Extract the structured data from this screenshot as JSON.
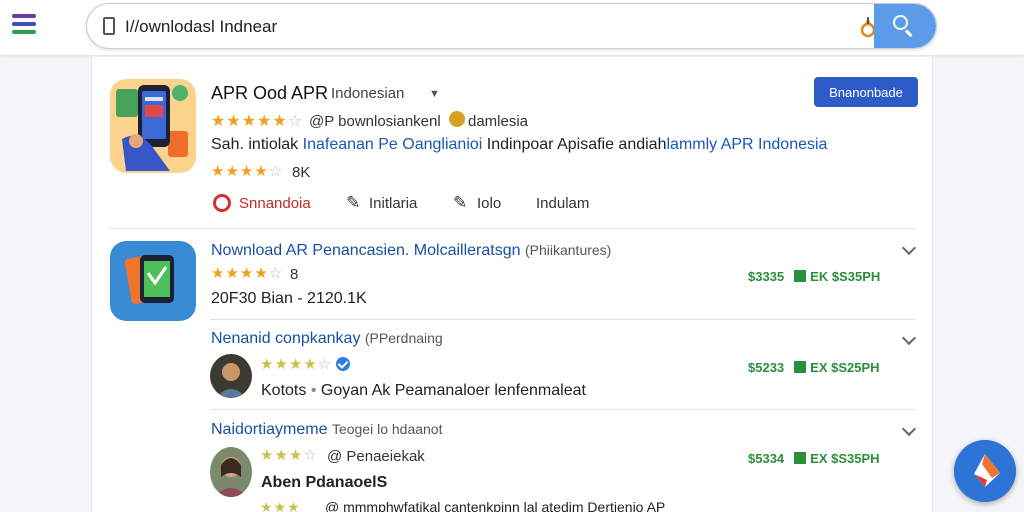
{
  "search": {
    "value": "I//ownlodasl Indnear"
  },
  "top_result": {
    "title": "APR Ood APR",
    "subtitle": "Indonesian",
    "rating_text": "@P bownlosiankenl",
    "rating_suffix": "damlesia",
    "description_plain": "Sah. intiolak",
    "description_blue": "Inafeanan Pe Oanglianioi",
    "description_plain2": "Indinpoar Apisafie andiah",
    "description_blue2": "lammly APR Indonesia",
    "rating2": "8K",
    "install_label": "Bnanonbade",
    "actions": {
      "share": "Snnandoia",
      "action2": "Initlaria",
      "action3": "Iolo",
      "action4": "Indulam"
    }
  },
  "results": [
    {
      "title": "Nownload AR Penancasien. Molcailleratsgn",
      "tag": "(Phiikantures)",
      "rating_count": "8",
      "size": "20F30 Bian - 2120.1K",
      "price": "$3335",
      "price2": "EK $S35PH"
    },
    {
      "title": "Nenanid conpkankay",
      "tag": "(PPerdnaing",
      "meta": "Kotots",
      "meta_rest": "Goyan Ak Peamanaloer lenfenmaleat",
      "price": "$5233",
      "price2": "EX $S25PH"
    },
    {
      "title": "Naidortiaymeme",
      "tag": "Teogei lo hdaanot",
      "rating_text": "@ Penaeiekak",
      "meta": "Aben PdanaoelS",
      "meta_rest": "",
      "price": "$5334",
      "price2": "EX $S35PH"
    }
  ],
  "bottom_line": "@ mmmphwfatikal cantenkpinn lal atedim Dertienio AP",
  "colors": {
    "accent": "#2f5bc8",
    "link": "#1a4fa3",
    "star": "#f0a01a",
    "price": "#2a8f3a"
  }
}
